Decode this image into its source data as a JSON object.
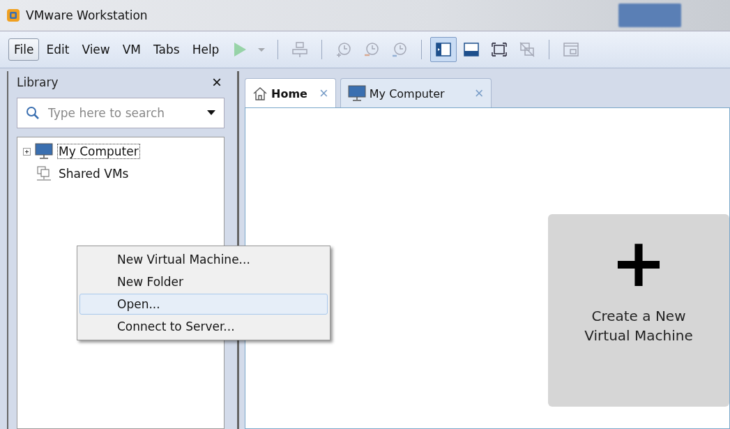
{
  "window": {
    "title": "VMware Workstation"
  },
  "menu_bar": [
    {
      "label": "File",
      "selected": true
    },
    {
      "label": "Edit",
      "selected": false
    },
    {
      "label": "View",
      "selected": false
    },
    {
      "label": "VM",
      "selected": false
    },
    {
      "label": "Tabs",
      "selected": false
    },
    {
      "label": "Help",
      "selected": false
    }
  ],
  "toolbar": [
    {
      "kind": "play",
      "disabled": true,
      "selected": false
    },
    {
      "kind": "caret",
      "disabled": true,
      "selected": false
    },
    {
      "kind": "sep"
    },
    {
      "kind": "network",
      "disabled": true,
      "selected": false
    },
    {
      "kind": "sep"
    },
    {
      "kind": "snapshot",
      "disabled": true,
      "selected": false
    },
    {
      "kind": "revert",
      "disabled": true,
      "selected": false
    },
    {
      "kind": "manage",
      "disabled": true,
      "selected": false
    },
    {
      "kind": "sep"
    },
    {
      "kind": "library",
      "disabled": false,
      "selected": true
    },
    {
      "kind": "thumbnail",
      "disabled": false,
      "selected": false
    },
    {
      "kind": "fullscreen",
      "disabled": false,
      "selected": false
    },
    {
      "kind": "unity",
      "disabled": true,
      "selected": false
    },
    {
      "kind": "sep"
    },
    {
      "kind": "console",
      "disabled": true,
      "selected": false
    }
  ],
  "library": {
    "title": "Library",
    "close": "×",
    "search": {
      "placeholder": "Type here to search"
    },
    "tree": [
      {
        "label": "My Computer",
        "kind": "computer",
        "expanded": false,
        "selected": true
      },
      {
        "label": "Shared VMs",
        "kind": "shared",
        "selected": false
      }
    ]
  },
  "tabs": [
    {
      "label": "Home",
      "kind": "home",
      "selected": true,
      "close": "×"
    },
    {
      "label": "My Computer",
      "kind": "computer",
      "selected": false,
      "close": "×"
    }
  ],
  "home": {
    "create_card": {
      "icon": "+",
      "label": "Create a New Virtual Machine"
    }
  },
  "context_menu": [
    {
      "label": "New Virtual Machine...",
      "selected": false
    },
    {
      "label": "New Folder",
      "selected": false
    },
    {
      "label": "Open...",
      "selected": true
    },
    {
      "label": "Connect to Server...",
      "selected": false
    }
  ]
}
